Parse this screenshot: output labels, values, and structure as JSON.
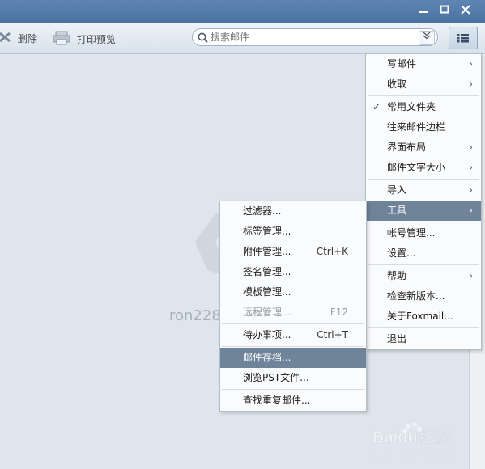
{
  "window": {
    "buttons": {
      "minimize": "▬",
      "maximize": "☐",
      "close": "✕"
    }
  },
  "toolbar": {
    "delete_label": "删除",
    "print_label": "打印预览",
    "search": {
      "placeholder": "搜索邮件",
      "value": ""
    }
  },
  "content": {
    "account_text": "ron228"
  },
  "main_menu": {
    "items": [
      {
        "label": "写邮件",
        "submenu": true
      },
      {
        "label": "收取",
        "submenu": true
      },
      {
        "label": "常用文件夹",
        "checked": true
      },
      {
        "label": "往来邮件边栏"
      },
      {
        "label": "界面布局",
        "submenu": true
      },
      {
        "label": "邮件文字大小",
        "submenu": true
      },
      {
        "label": "导入",
        "submenu": true
      },
      {
        "label": "工具",
        "submenu": true,
        "highlighted": true
      },
      {
        "label": "帐号管理..."
      },
      {
        "label": "设置..."
      },
      {
        "label": "帮助",
        "submenu": true
      },
      {
        "label": "检查新版本..."
      },
      {
        "label": "关于Foxmail..."
      },
      {
        "label": "退出"
      }
    ]
  },
  "tools_menu": {
    "items": [
      {
        "label": "过滤器..."
      },
      {
        "label": "标签管理..."
      },
      {
        "label": "附件管理...",
        "shortcut": "Ctrl+K"
      },
      {
        "label": "签名管理..."
      },
      {
        "label": "模板管理..."
      },
      {
        "label": "远程管理...",
        "shortcut": "F12",
        "disabled": true
      },
      {
        "label": "待办事项...",
        "shortcut": "Ctrl+T"
      },
      {
        "label": "邮件存档...",
        "highlighted": true
      },
      {
        "label": "浏览PST文件..."
      },
      {
        "label": "查找重复邮件..."
      }
    ]
  },
  "watermark": {
    "brand": "Baidu",
    "text": "经验",
    "url": "jingyan.baidu.com"
  },
  "colors": {
    "titlebar": "#4a72a1",
    "highlight": "#6f8399",
    "background": "#dfe5ec"
  }
}
